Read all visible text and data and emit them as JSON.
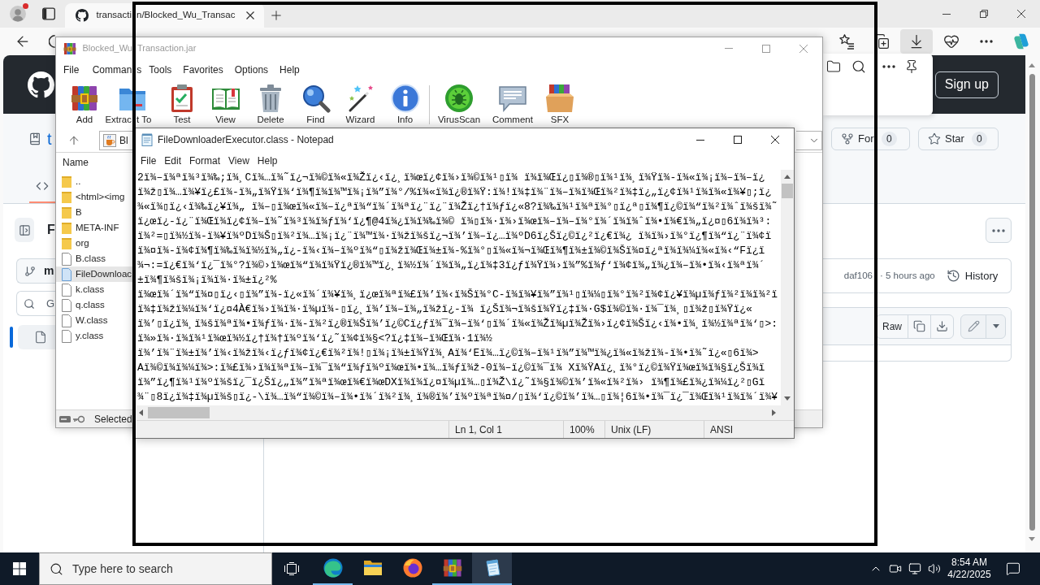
{
  "browser": {
    "tab": {
      "title_parts": [
        "transacti",
        "n/Blocked_Wu_Transac"
      ],
      "selected": true
    },
    "toolbar": [
      {
        "kind": "favorites",
        "selected": false
      },
      {
        "kind": "collections",
        "selected": false
      },
      {
        "kind": "downloads",
        "selected": true
      },
      {
        "kind": "performance",
        "selected": false
      },
      {
        "kind": "more",
        "selected": false
      },
      {
        "kind": "copilot",
        "selected": false
      }
    ]
  },
  "page": {
    "header": {
      "sign_up": "Sign up"
    },
    "repo": {
      "name": "t",
      "actions": [
        {
          "kind": "fork",
          "label": "For",
          "count": "0"
        },
        {
          "kind": "star",
          "label": "Star",
          "count": "0"
        }
      ]
    },
    "code_tab": {
      "selected": true
    },
    "sidebar": {
      "title": "F",
      "branch": "m",
      "search": {
        "placeholder": "G"
      },
      "file_item": {
        "selected": true
      }
    },
    "commit": {
      "hash": "daf106",
      "age": "· 5 hours ago",
      "history": "History"
    },
    "file_toolbar": {
      "raw": "Raw"
    }
  },
  "winrar": {
    "title_parts": [
      "Blocked_Wu",
      "Transaction.jar"
    ],
    "menu": [
      [
        "File"
      ],
      [
        "Comman",
        "s"
      ],
      [
        "Tools"
      ],
      [
        "Favorites"
      ],
      [
        "Options"
      ],
      [
        "Help"
      ]
    ],
    "toolbar_groups": [
      [
        {
          "kind": "add",
          "label": [
            "Add"
          ]
        },
        {
          "kind": "extract",
          "label": [
            "Extrac",
            "t To"
          ]
        },
        {
          "kind": "test",
          "label": [
            "Test"
          ]
        },
        {
          "kind": "view",
          "label": [
            "View"
          ]
        },
        {
          "kind": "delete",
          "label": [
            "Delete"
          ]
        },
        {
          "kind": "find",
          "label": [
            "Find"
          ]
        },
        {
          "kind": "wizard",
          "label": [
            "Wizard"
          ]
        },
        {
          "kind": "info",
          "label": [
            "Info"
          ]
        }
      ],
      [
        {
          "kind": "virusscan",
          "label": [
            "VirusScan"
          ]
        },
        {
          "kind": "comment",
          "label": [
            "Comment"
          ]
        },
        {
          "kind": "sfx",
          "label": [
            "SFX"
          ]
        }
      ]
    ],
    "path": "Bl",
    "columns": [
      "Name"
    ],
    "files": [
      {
        "name": "..",
        "kind": "folder",
        "selected": false
      },
      {
        "name": "<html><img",
        "kind": "folder",
        "selected": false
      },
      {
        "name": "B",
        "kind": "folder",
        "selected": false
      },
      {
        "name": "META-INF",
        "kind": "folder",
        "selected": false
      },
      {
        "name": "org",
        "kind": "folder",
        "selected": false
      },
      {
        "name": "B.class",
        "kind": "file",
        "selected": false
      },
      {
        "name": "FileDownloac",
        "kind": "file",
        "selected": true
      },
      {
        "name": "k.class",
        "kind": "file",
        "selected": false
      },
      {
        "name": "q.class",
        "kind": "file",
        "selected": false
      },
      {
        "name": "W.class",
        "kind": "file",
        "selected": false
      },
      {
        "name": "y.class",
        "kind": "file",
        "selected": false
      }
    ],
    "status": "Selected"
  },
  "notepad": {
    "title": "FileDownloaderExecutor.class - Notepad",
    "menu": [
      "File",
      "Edit",
      "Format",
      "View",
      "Help"
    ],
    "lines": [
      "2ï¾–ï¾ªï¾³ï¾‰;ï¾¸Cï¾…ï¾˜ï¿¬ï¾©ï¾«ï¾Žï¿‹ï¿¸ï¾œï¿¢ï¾›ï¾©ï¾¹▯ï¾ ï¾ï¾Œï¿▯ï¾®▯ï¾¹ï¾¸ï¾Ÿï¾-ï¾«ï¾¡ï¾–ï¾–ï¿",
      "ï¾ž▯ï¾…ï¾¥ï¿£ï¾-ï¾„ï¾Ÿï¾‘ï¾¶ï¾ï¾™ï¾¡ï¾”ï¾°/%ï¾«ï¾ï¿®ï¾Ÿ:ï¾!ï¾‡ï¾¨ï¾–ï¾ï¾Œï¾²ï¾‡ï¿„ï¿¢ï¾¹ï¾ï¾«ï¾¥▯;ï¿",
      "¾«ï¾▯ï¿‹ï¾‰ï¿¥ï¾„ ï¾–▯ï¾œï¾«ï¾–ï¿ªï¾“ï¾´ï¾ªï¿¨ï¿¨ï¾Žï¿†ï¾ƒï¿«8?ï¾‰ï¾¹ï¾ªï¾°▯ï¿ª▯ï¾¶ï¿©ï¾“ï¾²ï¾ˆï¾šï¾˜",
      "ï¿œï¿-ï¿¨ï¾Œï¾ï¿¢ï¾–ï¾˜ï¾³ï¾ï¾ƒï¾‘ï¿¶@4ï¾¿ï¾ï¾‰ï¾© ï¾▯ï¾·ï¾›ï¾œï¾–ï¾–ï¾°ï¾´ï¾ï¾ˆï¾•ï¾€ï¾„ï¿¤▯6ï¾ï¾³:",
      "ï¾²=▯ï¾½ï¾-ï¾¥ï¾ºDï¾Š▯ï¾²ï¾…ï¾¡ï¿¨ï¾™ï¾·ï¾žï¾šï¿¬ï¾’ï¾–ï¿…ï¾ºD6ï¿Šï¿©ï¿²ï¿€ï¾¿ ï¾ï¾›ï¾°ï¿¶ï¾“ï¿¨ï¾¢ï",
      "ï¾¤ï¾-ï¾¢ï¾¶ï¾‰ï¾ï¾½ï¾„ï¿-ï¾‹ï¾–ï¾ºï¾“▯ï¾žï¾Œï¾±ï¾-%ï¾°▯ï¾«ï¾¬ï¾Œï¾¶ï¾±ï¾©ï¾Šï¾¤ï¿ªï¾ï¾¼ï¾«ï¾‹“Fï¿ï",
      "¾¬:=ï¿€ï¾‘ï¿¯ï¾°?ï¾©›ï¾œï¾“ï¾ï¾Ÿï¿®ï¾™ï¿¸ï¾½ï¾´ï¾ï¾„ï¿ï¾‡3ï¿ƒï¾Ÿï¾›ï¾”%ï¾ƒ‘ï¾¢ï¾„ï¾¿ï¾–ï¾•ï¾‹ï¾ªï¾´",
      "±ï¾¶ï¾šï¾¡ï¾ï¾·ï¾±ï¿²%",
      "ï¾œï¾´ï¾“ï¾¤▯ï¿‹▯ï¾”ï¾-ï¿«ï¾´ï¾¥ï¾¸ï¿œï¾ªï¾£ï¾’ï¾‹ï¾Šï¾°C-ï¾ï¾¥ï¾”ï¾¹▯ï¾¼▯ï¾°ï¾²ï¾¢ï¿¥ï¾µï¾ƒï¾²ï¾ï¾²ï",
      "ï¾‡ï¾žï¾¼ï¾‘ï¿¤4À€ï¾›ï¾ï¾·ï¾µï¾-▯ï¿¸ï¾’ï¾–ï¾„ï¾žï¿-ï¾ ï¿Šï¾¬ï¾šï¾Ÿï¿‡ï¾·G$ï¾©ï¾·ï¾¯ï¾¸▯ï¾ž▯ï¾Ÿï¿«",
      "ï¾’▯ï¿ï¾¸ï¾šï¾ªï¾•ï¾ƒï¾·ï¾-ï¾²ï¿®ï¾Šï¾’ï¿©Cï¿ƒï¾¯ï¾–ï¾‘▯ï¾´ï¾«ï¾Žï¾µï¾Žï¾›ï¿¢ï¾Šï¿‹ï¾•ï¾¸ï¾½ï¾ªï¾‘▯>:",
      "ï¾»ï¾·ï¾ï¾¹ï¾œï¾½ï¿†ï¾†ï¾ºï¾‘ï¿˜ï¾¢ï¾§<?ï¿‡ï¾–ï¾Œï¾·1ï¾½",
      "ï¾’ï¾¨ï¾±ï¾’ï¾‹ï¾žï¾‹ï¿ƒï¾¢ï¿€ï¾²ï¾!▯ï¾¡ï¾±ï¾Ÿï¾¸Aï¾‘Eï¾…ï¿©ï¾–ï¾¹ï¾”ï¾™ï¾¿ï¾«ï¾žï¾-ï¾•ï¾˜ï¿«▯6ï¾>",
      "Aï¾©ï¾ï¾¼ï¾>:ï¾£ï¾›ï¾ï¾ªï¾–ï¾¯ï¾“ï¾ƒï¾ºï¾œï¾•ï¾…ï¾ƒï¾ž-0ï¾–ï¿©ï¾¯ï¾ Xï¾ŸAï¿¸ï¾°ï¿©ï¾Ÿï¾œï¾ï¾§ï¿Šï¾ï",
      "ï¾”ï¿¶ï¾¹ï¾ºï¾šï¿¯ï¿Šï¿„ï¾”ï¾ªï¾œï¾€ï¾œDXï¾ï¾ï¿¤ï¾µï¾…▯ï¾Ž\\ï¿˜ï¾§ï¾©ï¾’ï¾«ï¾²ï¾› ï¾¶ï¾£ï¾¿ï¾¼ï¿²▯Gï",
      "¾¨▯8ï¿ï¾‡ï¾µï¾š▯ï¿-\\ï¾…ï¾“ï¾©ï¾–ï¾•ï¾´ï¾²ï¾¸ï¾®ï¾’ï¾ºï¾ªï¾¤/▯ï¾‘ï¿©ï¾’ï¾…▯ï¾¦6ï¾•ï¾¯ï¿¯ï¾Œï¾¹ï¾ï¾´ï¾¥"
    ],
    "status": [
      "Ln 1, Col 1",
      "100%",
      "Unix (LF)",
      "ANSI"
    ]
  },
  "taskbar": {
    "search": {
      "placeholder": "Type here to search"
    },
    "apps": [
      {
        "kind": "edge",
        "running": true,
        "active": false
      },
      {
        "kind": "explorer",
        "running": false,
        "active": false
      },
      {
        "kind": "firefox",
        "running": false,
        "active": false
      },
      {
        "kind": "winrar",
        "running": true,
        "active": false
      },
      {
        "kind": "notepad",
        "running": true,
        "active": true
      }
    ],
    "time": "8:54 AM",
    "date": "4/22/2025"
  }
}
